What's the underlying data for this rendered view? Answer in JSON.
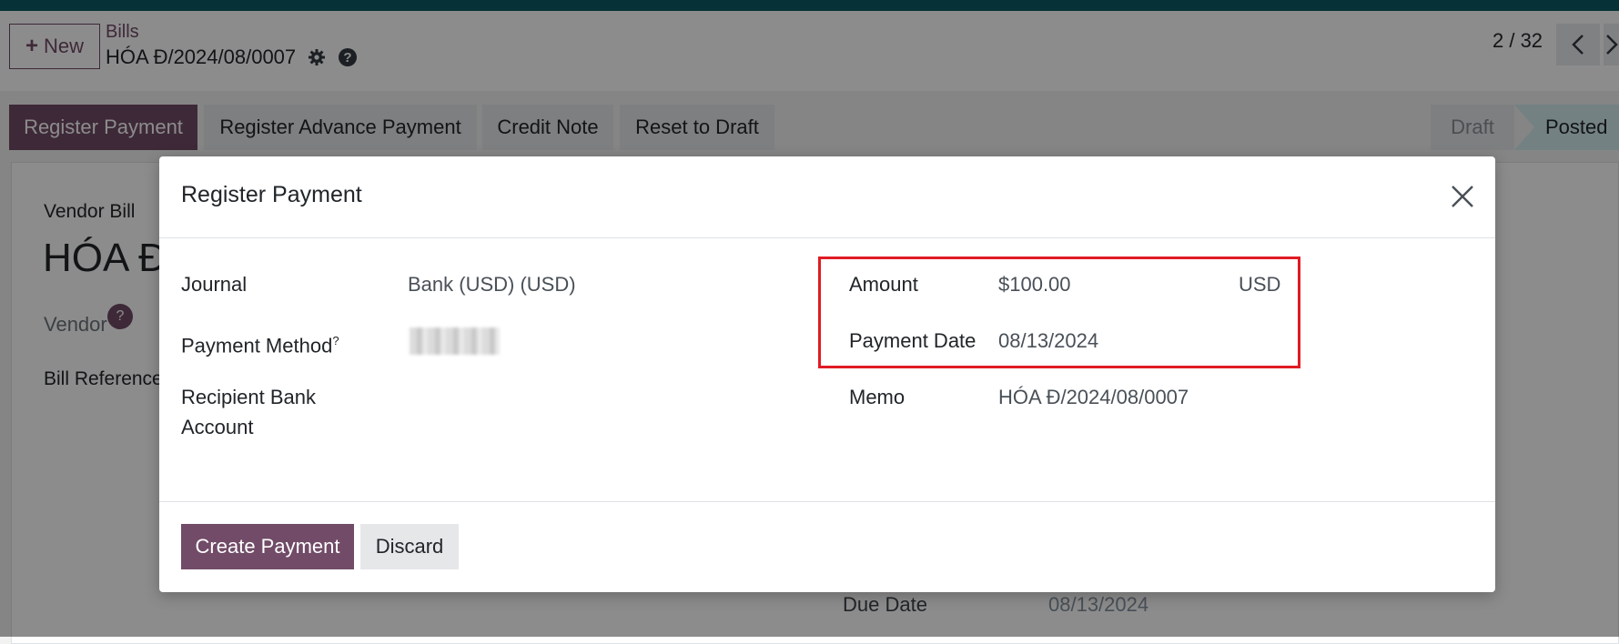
{
  "control_panel": {
    "new_label": "New",
    "breadcrumb": "Bills",
    "record_name": "HÓA Đ/2024/08/0007",
    "pager": "2 / 32"
  },
  "statusbar": {
    "buttons": [
      "Register Payment",
      "Register Advance Payment",
      "Credit Note",
      "Reset to Draft"
    ],
    "stages": [
      "Draft",
      "Posted"
    ]
  },
  "form": {
    "type_label": "Vendor Bill",
    "title": "HÓA Đ",
    "vendor_label": "Vendor",
    "vendor_help": "?",
    "bill_reference_label": "Bill Reference",
    "due_date_label": "Due Date",
    "due_date_value": "08/13/2024"
  },
  "dialog": {
    "title": "Register Payment",
    "journal_label": "Journal",
    "journal_value": "Bank (USD) (USD)",
    "payment_method_label": "Payment Method",
    "payment_method_help": "?",
    "recipient_bank_label_1": "Recipient Bank",
    "recipient_bank_label_2": "Account",
    "amount_label": "Amount",
    "amount_value": "$100.00",
    "currency": "USD",
    "payment_date_label": "Payment Date",
    "payment_date_value": "08/13/2024",
    "memo_label": "Memo",
    "memo_value": "HÓA Đ/2024/08/0007",
    "create_label": "Create Payment",
    "discard_label": "Discard"
  },
  "colors": {
    "accent": "#714b67",
    "topbar": "#0b5a63",
    "highlight": "#e01b24"
  }
}
